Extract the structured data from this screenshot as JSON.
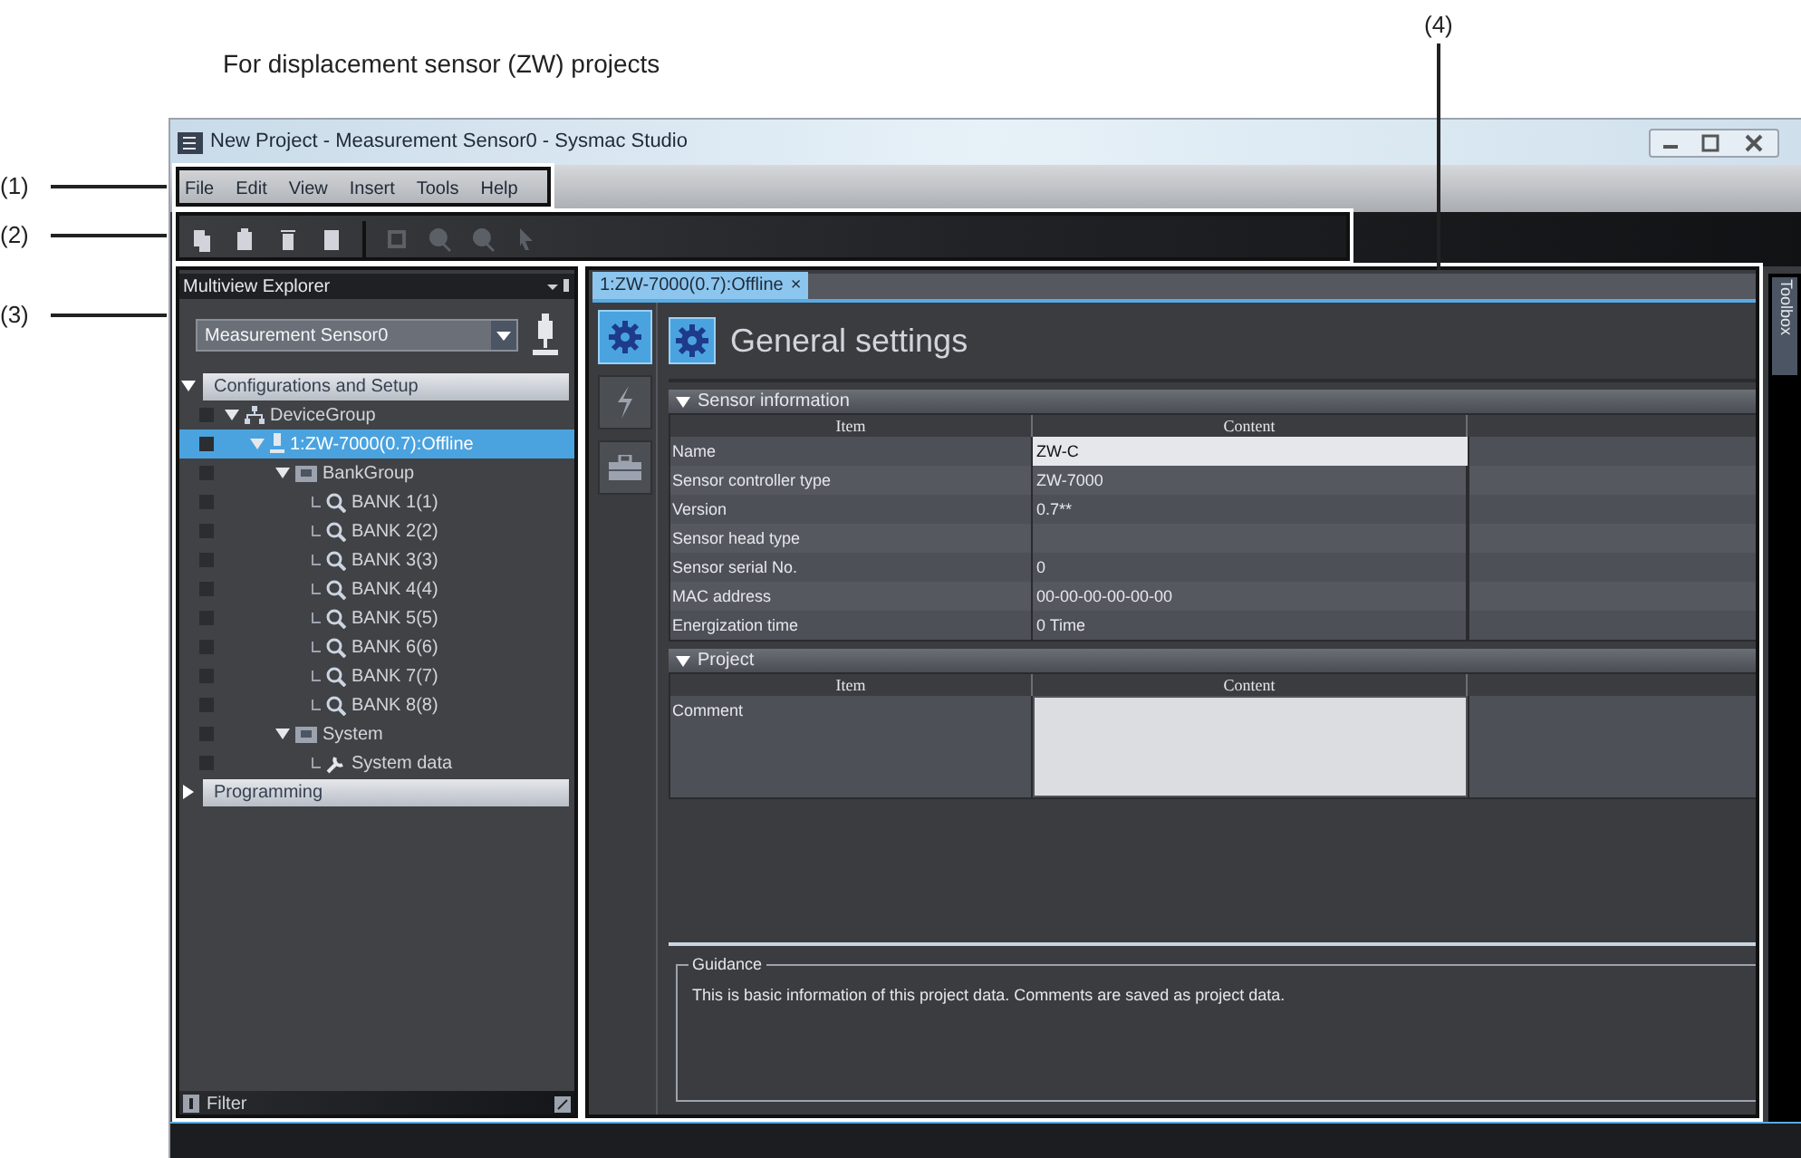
{
  "caption": "For displacement sensor (ZW) projects",
  "callouts": [
    {
      "label": "(1)"
    },
    {
      "label": "(2)"
    },
    {
      "label": "(3)"
    },
    {
      "label": "(4)"
    }
  ],
  "window": {
    "title": "New Project - Measurement Sensor0 - Sysmac Studio"
  },
  "menu": [
    "File",
    "Edit",
    "View",
    "Insert",
    "Tools",
    "Help"
  ],
  "toolbar": [
    {
      "kind": "copy",
      "disabled": false
    },
    {
      "kind": "paste",
      "disabled": false
    },
    {
      "kind": "delete",
      "disabled": false
    },
    {
      "kind": "help",
      "disabled": false
    },
    {
      "kind": "fit",
      "disabled": true
    },
    {
      "kind": "zoom-in",
      "disabled": true
    },
    {
      "kind": "zoom-out",
      "disabled": true
    },
    {
      "kind": "pointer",
      "disabled": true
    }
  ],
  "explorer": {
    "title": "Multiview Explorer",
    "device_select": "Measurement Sensor0",
    "filter": "Filter",
    "tree": [
      {
        "label": "Configurations and Setup",
        "kind": "section",
        "expanded": true,
        "selected": false,
        "children": [
          {
            "label": "DeviceGroup",
            "kind": "group",
            "expanded": true,
            "selected": false,
            "children": [
              {
                "label": "1:ZW-7000(0.7):Offline",
                "kind": "device",
                "expanded": true,
                "selected": true,
                "children": [
                  {
                    "label": "BankGroup",
                    "kind": "folder",
                    "expanded": true,
                    "selected": false,
                    "children": [
                      {
                        "label": "BANK 1(1)",
                        "kind": "bank",
                        "selected": false
                      },
                      {
                        "label": "BANK 2(2)",
                        "kind": "bank",
                        "selected": false
                      },
                      {
                        "label": "BANK 3(3)",
                        "kind": "bank",
                        "selected": false
                      },
                      {
                        "label": "BANK 4(4)",
                        "kind": "bank",
                        "selected": false
                      },
                      {
                        "label": "BANK 5(5)",
                        "kind": "bank",
                        "selected": false
                      },
                      {
                        "label": "BANK 6(6)",
                        "kind": "bank",
                        "selected": false
                      },
                      {
                        "label": "BANK 7(7)",
                        "kind": "bank",
                        "selected": false
                      },
                      {
                        "label": "BANK 8(8)",
                        "kind": "bank",
                        "selected": false
                      }
                    ]
                  },
                  {
                    "label": "System",
                    "kind": "folder",
                    "expanded": true,
                    "selected": false,
                    "children": [
                      {
                        "label": "System data",
                        "kind": "tool",
                        "selected": false
                      }
                    ]
                  }
                ]
              }
            ]
          }
        ]
      },
      {
        "label": "Programming",
        "kind": "section",
        "expanded": false,
        "selected": false
      }
    ]
  },
  "editor": {
    "tab": {
      "label": "1:ZW-7000(0.7):Offline",
      "close": "×"
    },
    "side_tabs": [
      {
        "kind": "settings",
        "selected": true
      },
      {
        "kind": "bolt",
        "selected": false
      },
      {
        "kind": "toolbox",
        "selected": false
      }
    ],
    "heading": "General settings",
    "sections": [
      {
        "title": "Sensor information",
        "expanded": true,
        "columns": [
          "Item",
          "Content"
        ],
        "rows": [
          {
            "item": "Name",
            "content": "ZW-C",
            "kind": "input"
          },
          {
            "item": "Sensor controller type",
            "content": "ZW-7000",
            "kind": "text"
          },
          {
            "item": "Version",
            "content": "0.7**",
            "kind": "text"
          },
          {
            "item": "Sensor head type",
            "kind": "text"
          },
          {
            "item": "Sensor serial No.",
            "content": "0",
            "kind": "text"
          },
          {
            "item": "MAC address",
            "content": "00-00-00-00-00-00",
            "kind": "text"
          },
          {
            "item": "Energization time",
            "content": "0 Time",
            "kind": "text"
          }
        ]
      },
      {
        "title": "Project",
        "expanded": true,
        "columns": [
          "Item",
          "Content"
        ],
        "rows": [
          {
            "item": "Comment",
            "kind": "textarea"
          }
        ]
      }
    ],
    "guidance": {
      "title": "Guidance",
      "text": "This is basic information of this project data. Comments are saved as project data."
    }
  },
  "toolbox": "Toolbox"
}
